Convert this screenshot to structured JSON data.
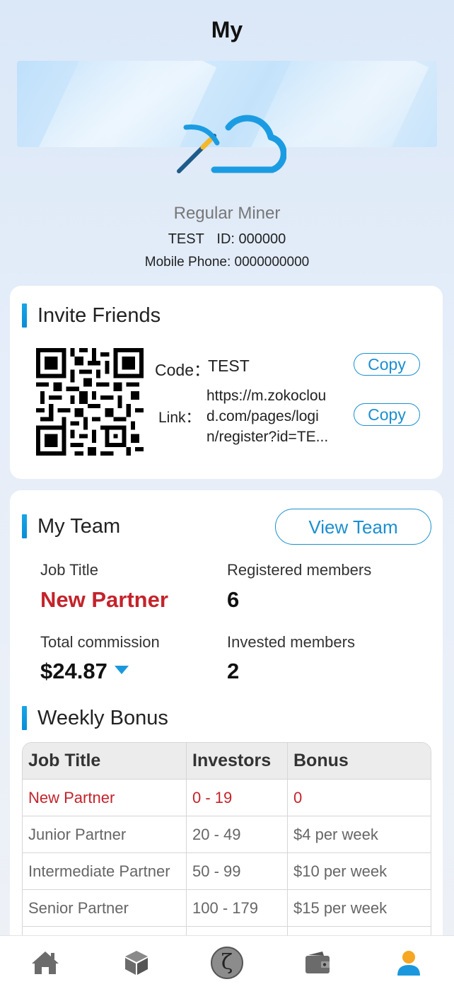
{
  "header": {
    "title": "My"
  },
  "profile": {
    "rank": "Regular Miner",
    "name": "TEST",
    "id_text": "ID: 000000",
    "phone_text": "Mobile Phone: 0000000000"
  },
  "invite": {
    "title": "Invite Friends",
    "code_label": "Code：",
    "code_value": "TEST",
    "link_label": "Link：",
    "link_line1": "https://m.zokoclou",
    "link_line2": "d.com/pages/logi",
    "link_line3": "n/register?id=TE...",
    "copy_label": "Copy"
  },
  "team": {
    "title": "My Team",
    "view_label": "View Team",
    "job_title_label": "Job Title",
    "job_title_value": "New Partner",
    "registered_label": "Registered members",
    "registered_value": "6",
    "commission_label": "Total commission",
    "commission_value": "$24.87",
    "invested_label": "Invested members",
    "invested_value": "2"
  },
  "bonus": {
    "title": "Weekly Bonus",
    "headers": [
      "Job Title",
      "Investors",
      "Bonus"
    ],
    "rows": [
      [
        "New Partner",
        "0 - 19",
        "0"
      ],
      [
        "Junior Partner",
        "20 - 49",
        "$4 per week"
      ],
      [
        "Intermediate Partner",
        "50 - 99",
        "$10 per week"
      ],
      [
        "Senior Partner",
        "100 - 179",
        "$15 per week"
      ]
    ]
  },
  "nav": {
    "items": [
      "home-icon",
      "box-icon",
      "zeta-icon",
      "wallet-icon",
      "user-icon"
    ],
    "zeta_glyph": "ζ"
  },
  "colors": {
    "accent": "#1b8fd0",
    "highlight": "#c4232b",
    "active_nav": "#1b98dd",
    "nav_icon": "#6b6b6b",
    "brand_orange": "#f5a623"
  }
}
